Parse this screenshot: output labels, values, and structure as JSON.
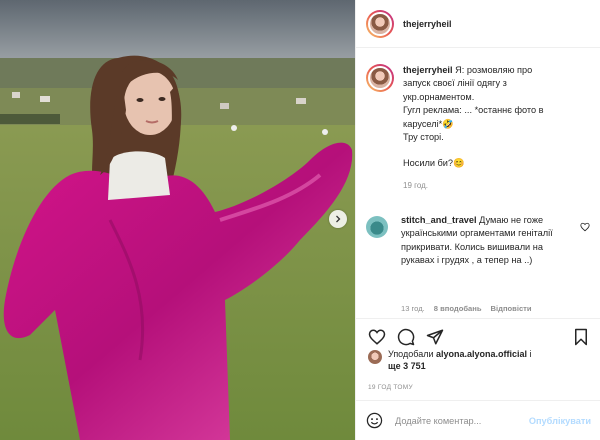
{
  "post": {
    "username": "thejerryheil",
    "caption": {
      "username": "thejerryheil",
      "line1": "Я: розмовляю про",
      "line2": "запуск своєї лінії одягу з",
      "line3": "укр.орнаментом.",
      "line4": "Гугл реклама: ... *останнє фото в",
      "line5": "каруселі*🤣",
      "line6": "Тру сторі.",
      "line7": "Носили би?😊",
      "time": "19 год."
    },
    "comment": {
      "username": "stitch_and_travel",
      "text": "Думаю не гоже українськими оргаментами геніталії прикривати. Колись вишивали на рукавах і грудях , а тепер на ..)",
      "time": "13 год.",
      "likes": "8 вподобань",
      "reply": "Відповісти"
    },
    "likes": {
      "prefix": "Уподобали",
      "user": "alyona.alyona.official",
      "connector": "і",
      "suffix": "ще 3 751"
    },
    "timeago": "19 ГОД ТОМУ",
    "add_comment": {
      "placeholder": "Додайте коментар...",
      "publish_label": "Опублікувати"
    }
  }
}
